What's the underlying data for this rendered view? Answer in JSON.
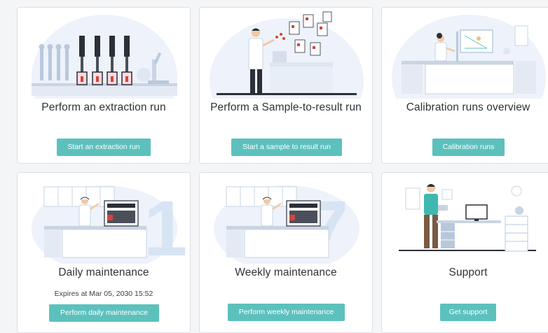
{
  "cards": [
    {
      "title": "Perform an extraction run",
      "button": "Start an extraction run"
    },
    {
      "title": "Perform a Sample-to-result run",
      "button": "Start a sample to result run"
    },
    {
      "title": "Calibration runs overview",
      "button": "Calibration runs"
    },
    {
      "title": "Daily maintenance",
      "subtitle": "Expires at Mar 05, 2030 15:52",
      "button": "Perform daily maintenance",
      "digit": "1"
    },
    {
      "title": "Weekly maintenance",
      "button": "Perform weekly maintenance",
      "digit": "7"
    },
    {
      "title": "Support",
      "button": "Get support"
    }
  ],
  "colors": {
    "accent": "#5cc1bd",
    "illustration_bg": "#eef2fa",
    "digit": "#d7e4f3",
    "red": "#d8433a",
    "dark": "#2b2f38"
  }
}
